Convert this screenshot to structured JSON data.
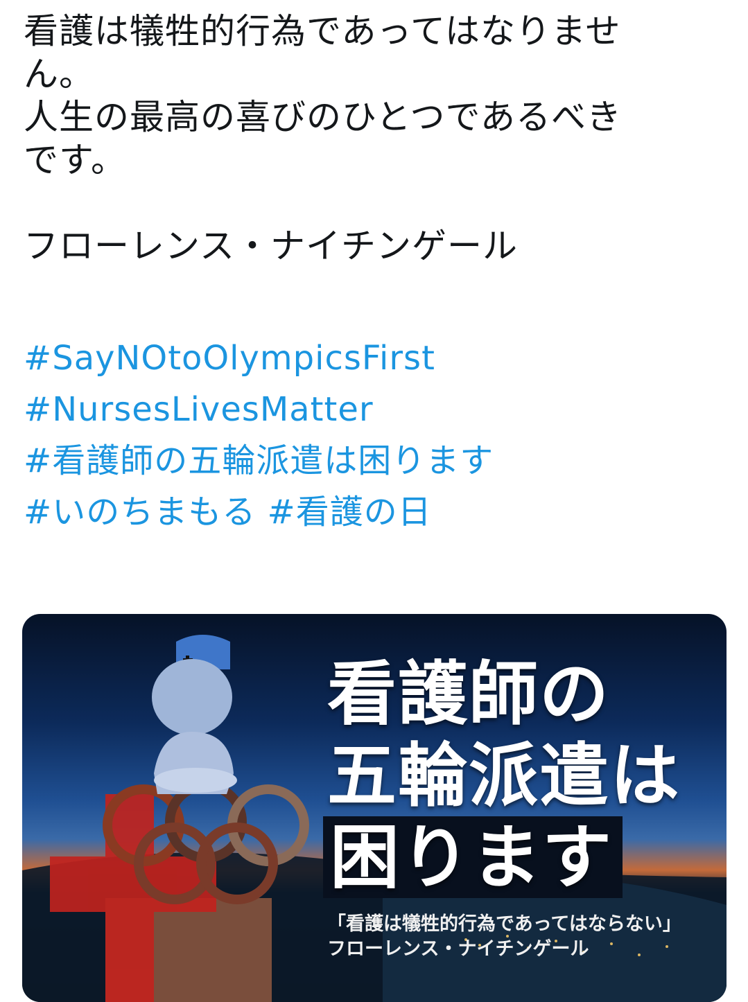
{
  "tweet": {
    "lines": [
      "看護は犠牲的行為であってはなりませ",
      "ん。",
      "人生の最高の喜びのひとつであるべき",
      "です。"
    ],
    "attribution": "フローレンス・ナイチンゲール",
    "hashtags": [
      "#SayNOtoOlympicsFirst",
      "#NursesLivesMatter",
      "#看護師の五輪派遣は困ります",
      "#いのちまもる",
      "#看護の日"
    ]
  },
  "media": {
    "title_lines": [
      "看護師の",
      "五輪派遣は",
      "困ります"
    ],
    "caption_lines": [
      "「看護は犠牲的行為であってはならない」",
      "フローレンス・ナイチンゲール"
    ],
    "colors": {
      "hashtag": "#1b95e0",
      "cross": "#c0231e",
      "sky_top": "#061227",
      "horizon": "#c46a3a"
    }
  }
}
